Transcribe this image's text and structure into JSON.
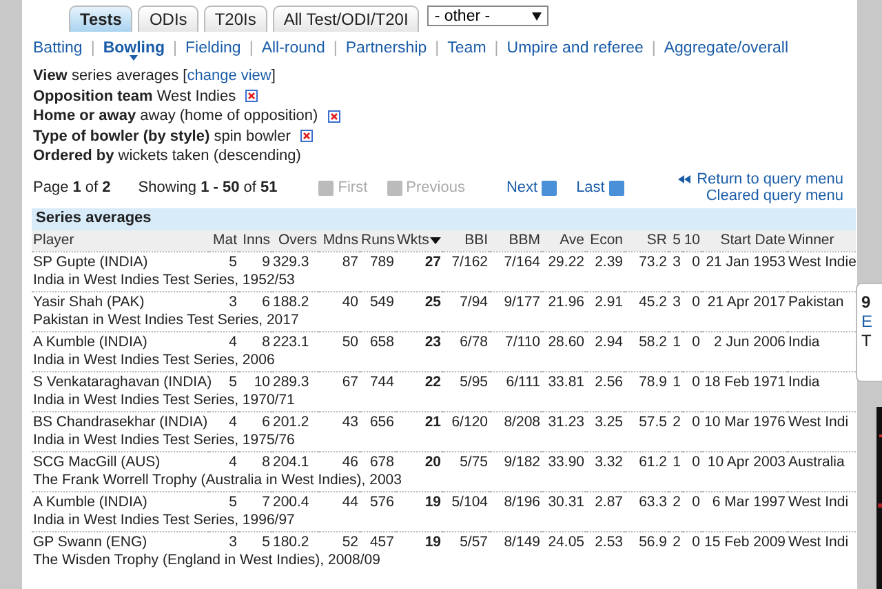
{
  "tabs": [
    {
      "label": "Tests",
      "selected": true
    },
    {
      "label": "ODIs",
      "selected": false
    },
    {
      "label": "T20Is",
      "selected": false
    },
    {
      "label": "All Test/ODI/T20I",
      "selected": false
    }
  ],
  "format_select": {
    "value": "- other -"
  },
  "nav_separator": "|",
  "nav_links": [
    {
      "label": "Batting",
      "selected": false
    },
    {
      "label": "Bowling",
      "selected": true
    },
    {
      "label": "Fielding",
      "selected": false
    },
    {
      "label": "All-round",
      "selected": false
    },
    {
      "label": "Partnership",
      "selected": false
    },
    {
      "label": "Team",
      "selected": false
    },
    {
      "label": "Umpire and referee",
      "selected": false
    },
    {
      "label": "Aggregate/overall",
      "selected": false
    }
  ],
  "filters": [
    {
      "label": "View",
      "value": "series averages",
      "link": "change view",
      "link_open": "[",
      "link_close": "]"
    },
    {
      "label": "Opposition team",
      "value": "West Indies",
      "removable": true
    },
    {
      "label": "Home or away",
      "value": "away (home of opposition)",
      "removable": true
    },
    {
      "label": "Type of bowler (by style)",
      "value": "spin bowler",
      "removable": true
    },
    {
      "label": "Ordered by",
      "value": "wickets taken (descending)"
    }
  ],
  "pager": {
    "page": "Page **1** of **2**",
    "showing": "Showing **1 - 50** of **51**",
    "buttons": [
      {
        "label": "First",
        "disabled": true
      },
      {
        "label": "Previous",
        "disabled": true
      },
      {
        "label": "Next",
        "disabled": false
      },
      {
        "label": "Last",
        "disabled": false
      }
    ],
    "return_link": "Return to query menu",
    "cleared_link": "Cleared query menu"
  },
  "table": {
    "title": "Series averages",
    "columns": [
      {
        "label": "Player",
        "sorted": false
      },
      {
        "label": "Mat",
        "sorted": false
      },
      {
        "label": "Inns",
        "sorted": false
      },
      {
        "label": "Overs",
        "sorted": false
      },
      {
        "label": "Mdns",
        "sorted": false
      },
      {
        "label": "Runs",
        "sorted": false
      },
      {
        "label": "Wkts",
        "sorted": true
      },
      {
        "label": "BBI",
        "sorted": false
      },
      {
        "label": "BBM",
        "sorted": false
      },
      {
        "label": "Ave",
        "sorted": false
      },
      {
        "label": "Econ",
        "sorted": false
      },
      {
        "label": "SR",
        "sorted": false
      },
      {
        "label": "5",
        "sorted": false
      },
      {
        "label": "10",
        "sorted": false
      },
      {
        "label": "Start Date",
        "sorted": false
      },
      {
        "label": "Winner",
        "sorted": false
      }
    ],
    "rows": [
      {
        "cells": [
          "SP Gupte (INDIA)",
          "5",
          "9",
          "329.3",
          "87",
          "789",
          "27",
          "7/162",
          "7/164",
          "29.22",
          "2.39",
          "73.2",
          "3",
          "0",
          "21 Jan 1953",
          "West Indie"
        ],
        "series": "India in West Indies Test Series, 1952/53"
      },
      {
        "cells": [
          "Yasir Shah (PAK)",
          "3",
          "6",
          "188.2",
          "40",
          "549",
          "25",
          "7/94",
          "9/177",
          "21.96",
          "2.91",
          "45.2",
          "3",
          "0",
          "21 Apr 2017",
          "Pakistan"
        ],
        "series": "Pakistan in West Indies Test Series, 2017"
      },
      {
        "cells": [
          "A Kumble (INDIA)",
          "4",
          "8",
          "223.1",
          "50",
          "658",
          "23",
          "6/78",
          "7/110",
          "28.60",
          "2.94",
          "58.2",
          "1",
          "0",
          "2 Jun 2006",
          "India"
        ],
        "series": "India in West Indies Test Series, 2006"
      },
      {
        "cells": [
          "S Venkataraghavan (INDIA)",
          "5",
          "10",
          "289.3",
          "67",
          "744",
          "22",
          "5/95",
          "6/111",
          "33.81",
          "2.56",
          "78.9",
          "1",
          "0",
          "18 Feb 1971",
          "India"
        ],
        "series": "India in West Indies Test Series, 1970/71"
      },
      {
        "cells": [
          "BS Chandrasekhar (INDIA)",
          "4",
          "6",
          "201.2",
          "43",
          "656",
          "21",
          "6/120",
          "8/208",
          "31.23",
          "3.25",
          "57.5",
          "2",
          "0",
          "10 Mar 1976",
          "West Indi"
        ],
        "series": "India in West Indies Test Series, 1975/76"
      },
      {
        "cells": [
          "SCG MacGill (AUS)",
          "4",
          "8",
          "204.1",
          "46",
          "678",
          "20",
          "5/75",
          "9/182",
          "33.90",
          "3.32",
          "61.2",
          "1",
          "0",
          "10 Apr 2003",
          "Australia"
        ],
        "series": "The Frank Worrell Trophy (Australia in West Indies), 2003"
      },
      {
        "cells": [
          "A Kumble (INDIA)",
          "5",
          "7",
          "200.4",
          "44",
          "576",
          "19",
          "5/104",
          "8/196",
          "30.31",
          "2.87",
          "63.3",
          "2",
          "0",
          "6 Mar 1997",
          "West Indi"
        ],
        "series": "India in West Indies Test Series, 1996/97"
      },
      {
        "cells": [
          "GP Swann (ENG)",
          "3",
          "5",
          "180.2",
          "52",
          "457",
          "19",
          "5/57",
          "8/149",
          "24.05",
          "2.53",
          "56.9",
          "2",
          "0",
          "15 Feb 2009",
          "West Indi"
        ],
        "series": "The Wisden Trophy (England in West Indies), 2008/09"
      }
    ]
  },
  "side_card": {
    "lines": [
      {
        "text": "9",
        "kind": "heading"
      },
      {
        "text": "E",
        "kind": "link"
      },
      {
        "text": "T",
        "kind": "plain"
      }
    ]
  }
}
